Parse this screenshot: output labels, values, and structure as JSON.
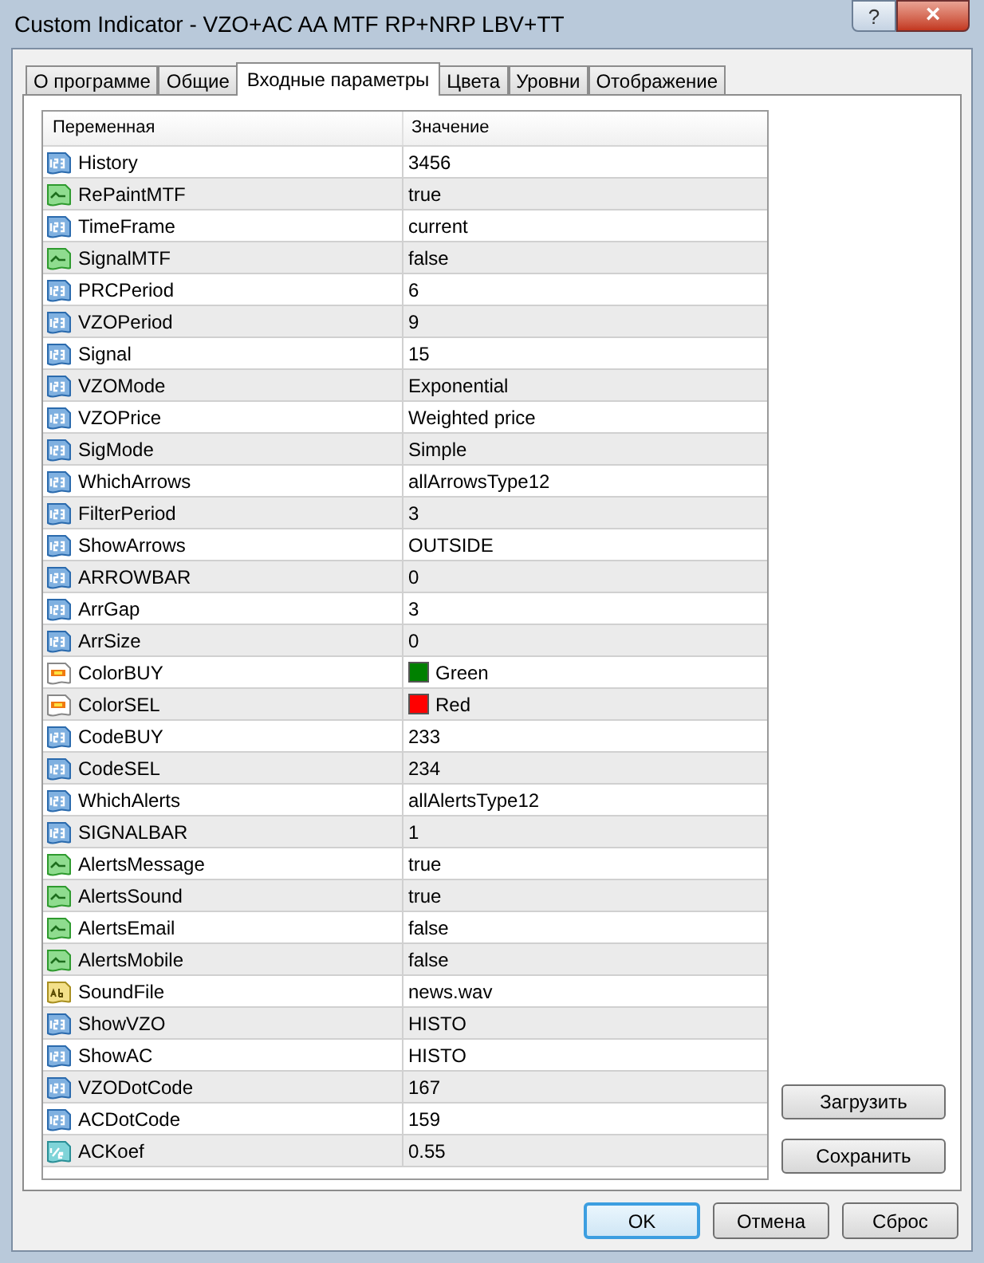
{
  "window": {
    "title": "Custom Indicator - VZO+AC AA MTF RP+NRP LBV+TT",
    "help_glyph": "?",
    "close_glyph": "×"
  },
  "tabs": [
    {
      "label": "О программе",
      "selected": false
    },
    {
      "label": "Общие",
      "selected": false
    },
    {
      "label": "Входные параметры",
      "selected": true
    },
    {
      "label": "Цвета",
      "selected": false
    },
    {
      "label": "Уровни",
      "selected": false
    },
    {
      "label": "Отображение",
      "selected": false
    }
  ],
  "table": {
    "columns": [
      "Переменная",
      "Значение"
    ],
    "rows": [
      {
        "kind": "int",
        "name": "History",
        "value": "3456"
      },
      {
        "kind": "bool",
        "name": "RePaintMTF",
        "value": "true"
      },
      {
        "kind": "int",
        "name": "TimeFrame",
        "value": "current"
      },
      {
        "kind": "bool",
        "name": "SignalMTF",
        "value": "false"
      },
      {
        "kind": "int",
        "name": "PRCPeriod",
        "value": "6"
      },
      {
        "kind": "int",
        "name": "VZOPeriod",
        "value": "9"
      },
      {
        "kind": "int",
        "name": "Signal",
        "value": "15"
      },
      {
        "kind": "int",
        "name": "VZOMode",
        "value": "Exponential"
      },
      {
        "kind": "int",
        "name": "VZOPrice",
        "value": "Weighted price"
      },
      {
        "kind": "int",
        "name": "SigMode",
        "value": "Simple"
      },
      {
        "kind": "int",
        "name": "WhichArrows",
        "value": "allArrowsType12"
      },
      {
        "kind": "int",
        "name": "FilterPeriod",
        "value": "3"
      },
      {
        "kind": "int",
        "name": "ShowArrows",
        "value": "OUTSIDE"
      },
      {
        "kind": "int",
        "name": "ARROWBAR",
        "value": "0"
      },
      {
        "kind": "int",
        "name": "ArrGap",
        "value": "3"
      },
      {
        "kind": "int",
        "name": "ArrSize",
        "value": "0"
      },
      {
        "kind": "color",
        "name": "ColorBUY",
        "value": "Green",
        "color": "#008000"
      },
      {
        "kind": "color",
        "name": "ColorSEL",
        "value": "Red",
        "color": "#ff0000"
      },
      {
        "kind": "int",
        "name": "CodeBUY",
        "value": "233"
      },
      {
        "kind": "int",
        "name": "CodeSEL",
        "value": "234"
      },
      {
        "kind": "int",
        "name": "WhichAlerts",
        "value": "allAlertsType12"
      },
      {
        "kind": "int",
        "name": "SIGNALBAR",
        "value": "1"
      },
      {
        "kind": "bool",
        "name": "AlertsMessage",
        "value": "true"
      },
      {
        "kind": "bool",
        "name": "AlertsSound",
        "value": "true"
      },
      {
        "kind": "bool",
        "name": "AlertsEmail",
        "value": "false"
      },
      {
        "kind": "bool",
        "name": "AlertsMobile",
        "value": "false"
      },
      {
        "kind": "string",
        "name": "SoundFile",
        "value": "news.wav"
      },
      {
        "kind": "int",
        "name": "ShowVZO",
        "value": "HISTO"
      },
      {
        "kind": "int",
        "name": "ShowAC",
        "value": "HISTO"
      },
      {
        "kind": "int",
        "name": "VZODotCode",
        "value": "167"
      },
      {
        "kind": "int",
        "name": "ACDotCode",
        "value": "159"
      },
      {
        "kind": "double",
        "name": "ACKoef",
        "value": "0.55"
      }
    ]
  },
  "side_buttons": [
    "Загрузить",
    "Сохранить"
  ],
  "footer_buttons": [
    {
      "label": "OK",
      "default": true
    },
    {
      "label": "Отмена",
      "default": false
    },
    {
      "label": "Сброс",
      "default": false
    }
  ]
}
